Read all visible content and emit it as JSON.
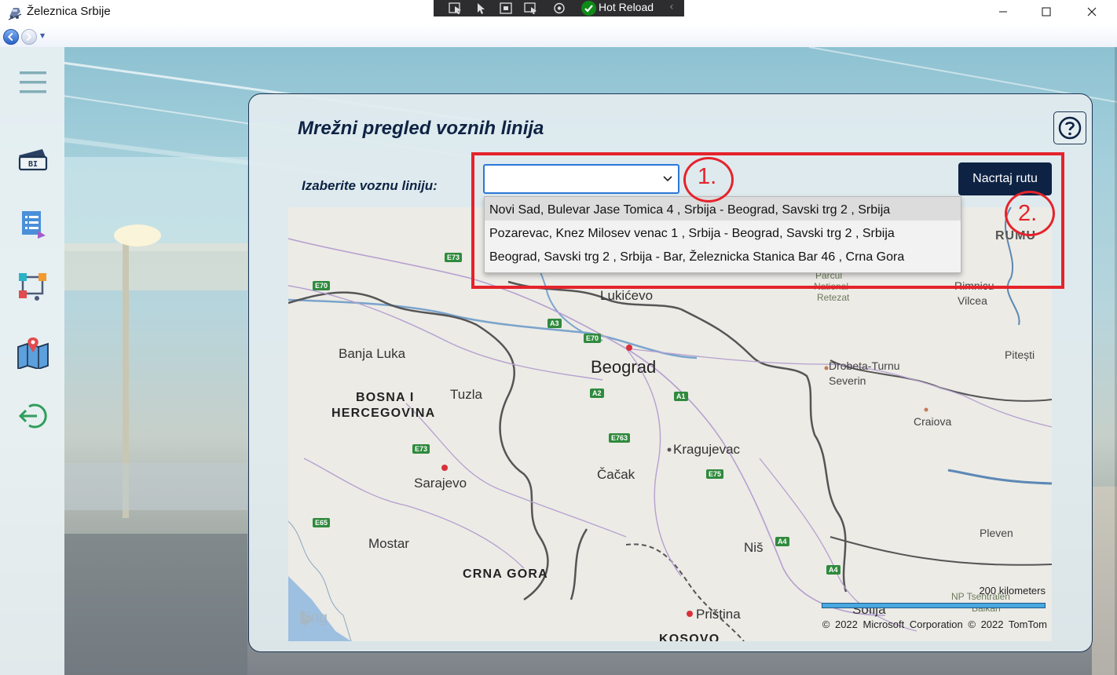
{
  "window": {
    "title": "Železnica Srbije",
    "dev_toolbar": {
      "hot_reload_label": "Hot Reload"
    }
  },
  "sidebar": {
    "items": [
      {
        "icon": "hamburger-menu-icon"
      },
      {
        "icon": "ticket-icon"
      },
      {
        "icon": "timetable-list-icon"
      },
      {
        "icon": "route-network-icon"
      },
      {
        "icon": "map-pin-icon"
      },
      {
        "icon": "logout-arrow-icon"
      }
    ]
  },
  "main": {
    "title": "Mrežni pregled voznih linija",
    "select_label": "Izaberite voznu liniju:",
    "select_value": "",
    "draw_button_label": "Nacrtaj rutu",
    "help_icon": "question-mark-icon",
    "dropdown_options": [
      "Novi Sad, Bulevar Jase Tomica 4 , Srbija - Beograd, Savski trg 2 , Srbija",
      "Pozarevac, Knez Milosev venac 1 , Srbija - Beograd, Savski trg 2 , Srbija",
      "Beograd, Savski trg 2 , Srbija - Bar, Železnicka Stanica Bar 46 , Crna Gora"
    ]
  },
  "annotations": {
    "first": "1.",
    "second": "2."
  },
  "map": {
    "labels": {
      "lukicevo": "Lukićevo",
      "beograd": "Beograd",
      "banja_luka": "Banja Luka",
      "tuzla": "Tuzla",
      "bih_line1": "BOSNA I",
      "bih_line2": "HERCEGOVINA",
      "kragujevac": "Kragujevac",
      "cacak": "Čačak",
      "sarajevo": "Sarajevo",
      "mostar": "Mostar",
      "crna_gora": "CRNA GORA",
      "nis": "Niš",
      "pristina": "Priština",
      "kosovo": "KOSOVO",
      "sofija": "Sofija",
      "drobeta": "Drobeta-Turnu",
      "severin": "Severin",
      "craiova": "Craiova",
      "pitesti": "Pitești",
      "rimnicu": "Rimnicu",
      "vilcea": "Vilcea",
      "pleven": "Pleven",
      "romania": "RUMU",
      "parcul": "Parcul",
      "national": "National",
      "retezat": "Retezat",
      "np_isentralen": "NP Tsentralen",
      "balkan": "Balkan"
    },
    "road_shields": [
      "E73",
      "E70",
      "A3",
      "E70",
      "A2",
      "A1",
      "E763",
      "E73",
      "E75",
      "E65",
      "A4",
      "A4"
    ],
    "scale_label": "200 kilometers",
    "copyright": "© 2022 Microsoft Corporation   © 2022 TomTom",
    "logo_text": "bing"
  }
}
